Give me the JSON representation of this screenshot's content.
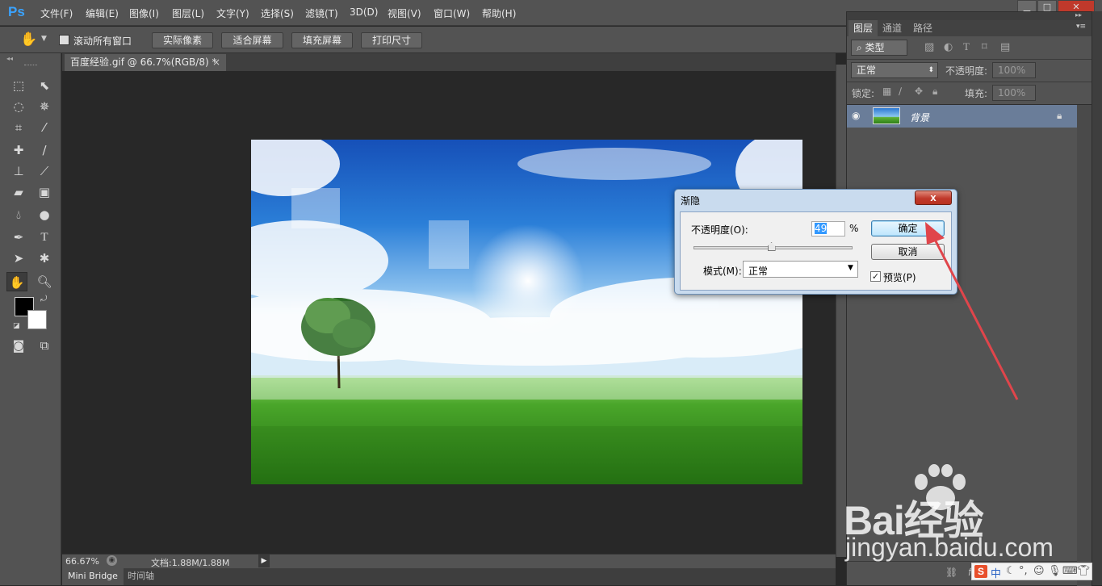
{
  "app": {
    "logo": "Ps"
  },
  "menu": [
    "文件(F)",
    "编辑(E)",
    "图像(I)",
    "图层(L)",
    "文字(Y)",
    "选择(S)",
    "滤镜(T)",
    "3D(D)",
    "视图(V)",
    "窗口(W)",
    "帮助(H)"
  ],
  "options": {
    "scroll_all_windows": "滚动所有窗口",
    "buttons": [
      "实际像素",
      "适合屏幕",
      "填充屏幕",
      "打印尺寸"
    ]
  },
  "document": {
    "tab_title": "百度经验.gif @ 66.7%(RGB/8) *",
    "close": "×"
  },
  "status": {
    "zoom": "66.67%",
    "doc_info": "文档:1.88M/1.88M"
  },
  "bottom_tabs": [
    "Mini Bridge",
    "时间轴"
  ],
  "layers_panel": {
    "tabs": [
      "图层",
      "通道",
      "路径"
    ],
    "filter_kind": "类型",
    "blend_mode": "正常",
    "opacity_label": "不透明度:",
    "opacity_value": "100%",
    "lock_label": "锁定:",
    "fill_label": "填充:",
    "fill_value": "100%",
    "layer_name": "背景"
  },
  "fade_dialog": {
    "title": "渐隐",
    "opacity_label": "不透明度(O):",
    "opacity_value": "49",
    "percent": "%",
    "opacity_slider": 0.49,
    "mode_label": "模式(M):",
    "mode_value": "正常",
    "ok": "确定",
    "cancel": "取消",
    "preview_label": "预览(P)",
    "preview_checked": true,
    "close": "x"
  },
  "watermark": {
    "brand": "Bai经验",
    "url": "jingyan.baidu.com"
  },
  "ime_tray": {
    "label": "中"
  },
  "colors": {
    "ps_blue": "#3aa3ff",
    "panel": "#535353",
    "canvas_bg": "#282828",
    "arrow": "#e0454b"
  }
}
